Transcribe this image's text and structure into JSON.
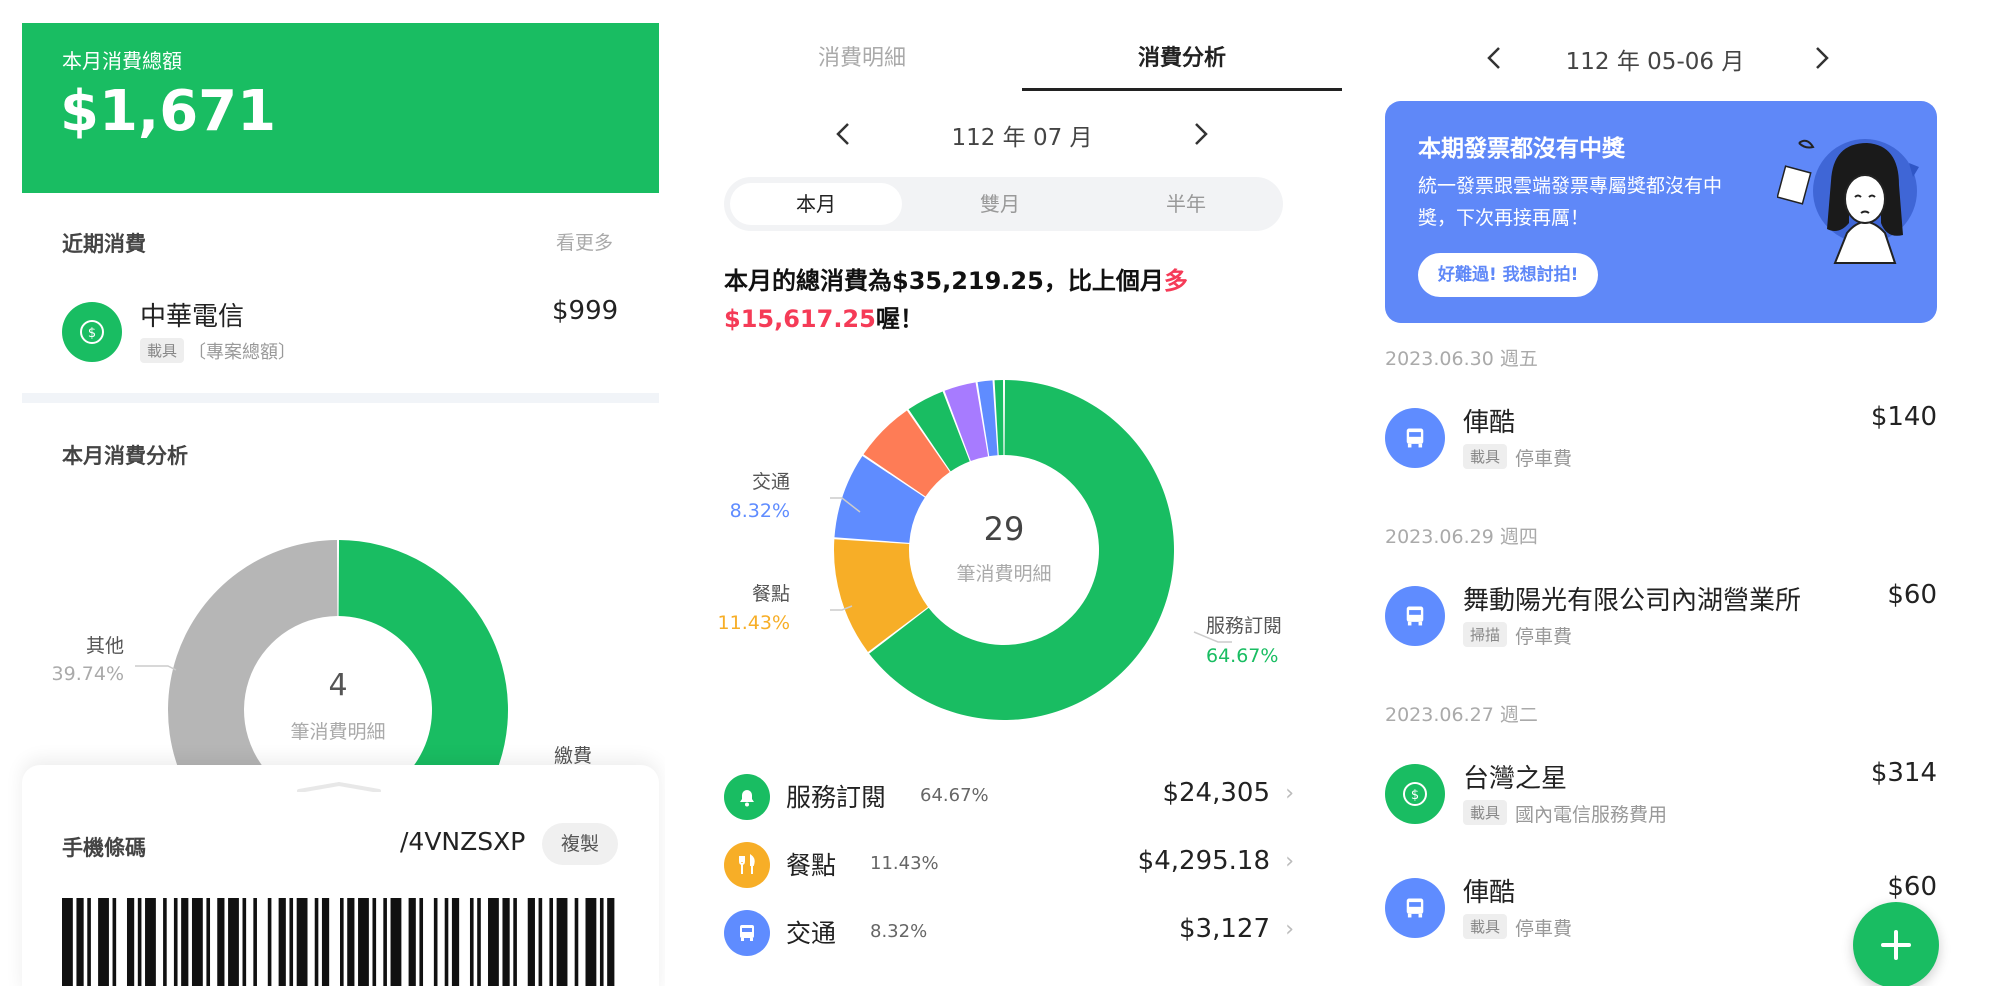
{
  "colors": {
    "brand_green": "#19bd62",
    "blue": "#5f8cff",
    "orange": "#f7ae27",
    "red": "#f53b57",
    "coral": "#fe7c56",
    "purple": "#a77bff",
    "grey": "#b6b6b6",
    "banner": "#5f88f8"
  },
  "panel1": {
    "total_label": "本月消費總額",
    "total_value": "$1,671",
    "recent_title": "近期消費",
    "see_more": "看更多",
    "recent_item": {
      "name": "中華電信",
      "tag": "載具",
      "sub": "〔專案總額〕",
      "amount": "$999",
      "icon": "dollar-icon"
    },
    "analysis_title": "本月消費分析",
    "donut_center_num": "4",
    "donut_center_label": "筆消費明細",
    "labels": {
      "other_name": "其他",
      "other_pct": "39.74%",
      "fee_name": "繳費"
    },
    "barcode_title": "手機條碼",
    "barcode_code": "/4VNZSXP",
    "copy_label": "複製"
  },
  "panel2": {
    "tabs": [
      {
        "label": "消費明細"
      },
      {
        "label": "消費分析"
      }
    ],
    "period": "112 年 07 月",
    "segments": [
      {
        "label": "本月"
      },
      {
        "label": "雙月"
      },
      {
        "label": "半年"
      }
    ],
    "summary_line1_prefix": "本月的總消費為$35,219.25，比上個月",
    "summary_line1_highlight": "多",
    "summary_line2_highlight": "$15,617.25",
    "summary_line2_suffix": "喔！",
    "donut_center_num": "29",
    "donut_center_label": "筆消費明細",
    "labels": {
      "traffic_name": "交通",
      "traffic_pct": "8.32%",
      "meal_name": "餐點",
      "meal_pct": "11.43%",
      "service_name": "服務訂閱",
      "service_pct": "64.67%"
    },
    "categories": [
      {
        "name": "服務訂閱",
        "pct": "64.67%",
        "amount": "$24,305",
        "icon": "bell-icon"
      },
      {
        "name": "餐點",
        "pct": "11.43%",
        "amount": "$4,295.18",
        "icon": "fork-knife-icon"
      },
      {
        "name": "交通",
        "pct": "8.32%",
        "amount": "$3,127",
        "icon": "bus-icon"
      }
    ]
  },
  "panel3": {
    "period": "112 年 05-06 月",
    "banner_title": "本期發票都沒有中獎",
    "banner_line1": "統一發票跟雲端發票專屬獎都沒有中",
    "banner_line2": "獎，下次再接再厲！",
    "banner_button": "好難過! 我想討拍!",
    "groups": [
      {
        "date": "2023.06.30 週五",
        "items": [
          {
            "name": "俥酷",
            "tag": "載具",
            "sub": "停車費",
            "amount": "$140",
            "icon": "bus-icon"
          }
        ]
      },
      {
        "date": "2023.06.29 週四",
        "items": [
          {
            "name": "舞動陽光有限公司內湖營業所",
            "tag": "掃描",
            "sub": "停車費",
            "amount": "$60",
            "icon": "bus-icon"
          }
        ]
      },
      {
        "date": "2023.06.27 週二",
        "items": [
          {
            "name": "台灣之星",
            "tag": "載具",
            "sub": "國內電信服務費用",
            "amount": "$314",
            "icon": "dollar-icon"
          },
          {
            "name": "俥酷",
            "tag": "載具",
            "sub": "停車費",
            "amount": "$60",
            "icon": "bus-icon"
          }
        ]
      }
    ],
    "fab_icon": "plus-icon"
  },
  "chart_data": [
    {
      "type": "pie",
      "title": "",
      "values": [
        {
          "label": "繳費",
          "value": 60.26
        },
        {
          "label": "其他",
          "value": 39.74
        }
      ],
      "center_text": "4 筆消費明細"
    },
    {
      "type": "pie",
      "title": "",
      "values": [
        {
          "label": "服務訂閱",
          "value": 64.67
        },
        {
          "label": "餐點",
          "value": 11.43
        },
        {
          "label": "交通",
          "value": 8.32
        },
        {
          "label": "",
          "value": 6.0
        },
        {
          "label": "",
          "value": 3.8
        },
        {
          "label": "",
          "value": 3.2
        },
        {
          "label": "",
          "value": 1.6
        },
        {
          "label": "",
          "value": 0.98
        }
      ],
      "center_text": "29 筆消費明細"
    }
  ]
}
